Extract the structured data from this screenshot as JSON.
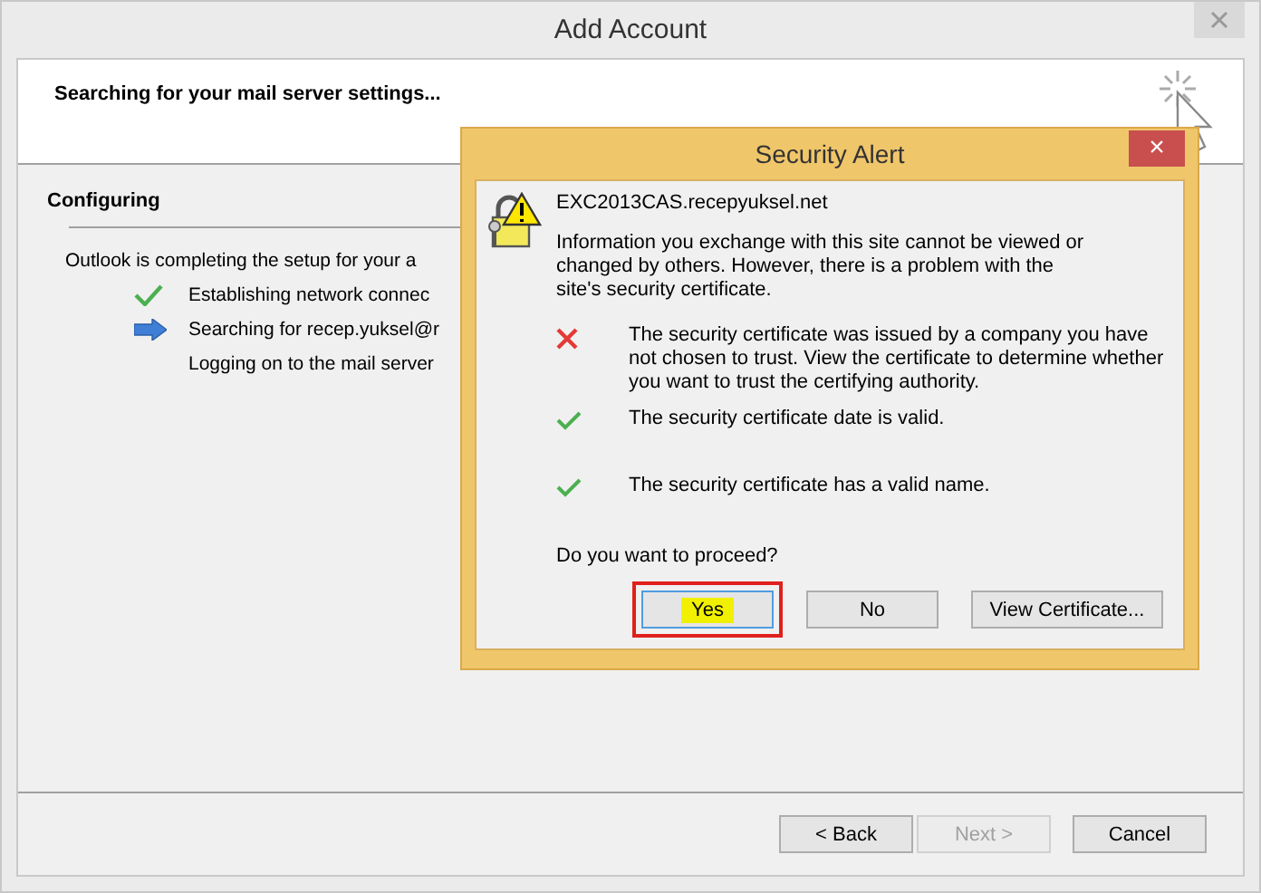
{
  "window": {
    "title": "Add Account"
  },
  "header": {
    "heading": "Searching for your mail server settings..."
  },
  "section": {
    "title": "Configuring",
    "intro": "Outlook is completing the setup for your a"
  },
  "steps": [
    {
      "kind": "done",
      "label": "Establishing network connec"
    },
    {
      "kind": "current",
      "label": "Searching for recep.yuksel@r"
    },
    {
      "kind": "pending",
      "label": "Logging on to the mail server"
    }
  ],
  "buttons": [
    {
      "label": "< Back",
      "disabled": false
    },
    {
      "label": "Next >",
      "disabled": true
    },
    {
      "label": "Cancel",
      "disabled": false
    }
  ],
  "alert": {
    "title": "Security Alert",
    "close": "×",
    "server": "EXC2013CAS.recepyuksel.net",
    "message": "Information you exchange with this site cannot be viewed or changed by others. However, there is a problem with the site's security certificate.",
    "checks": [
      {
        "kind": "fail",
        "text": "The security certificate was issued by a company you have not chosen to trust. View the certificate to determine whether you want to trust the certifying authority."
      },
      {
        "kind": "ok",
        "text": "The security certificate date is valid."
      },
      {
        "kind": "ok",
        "text": "The security certificate has a valid name."
      }
    ],
    "question": "Do you want to proceed?",
    "buttons": [
      {
        "label": "Yes",
        "highlighted": true
      },
      {
        "label": "No",
        "highlighted": false
      },
      {
        "label": "View Certificate...",
        "highlighted": false
      }
    ]
  }
}
